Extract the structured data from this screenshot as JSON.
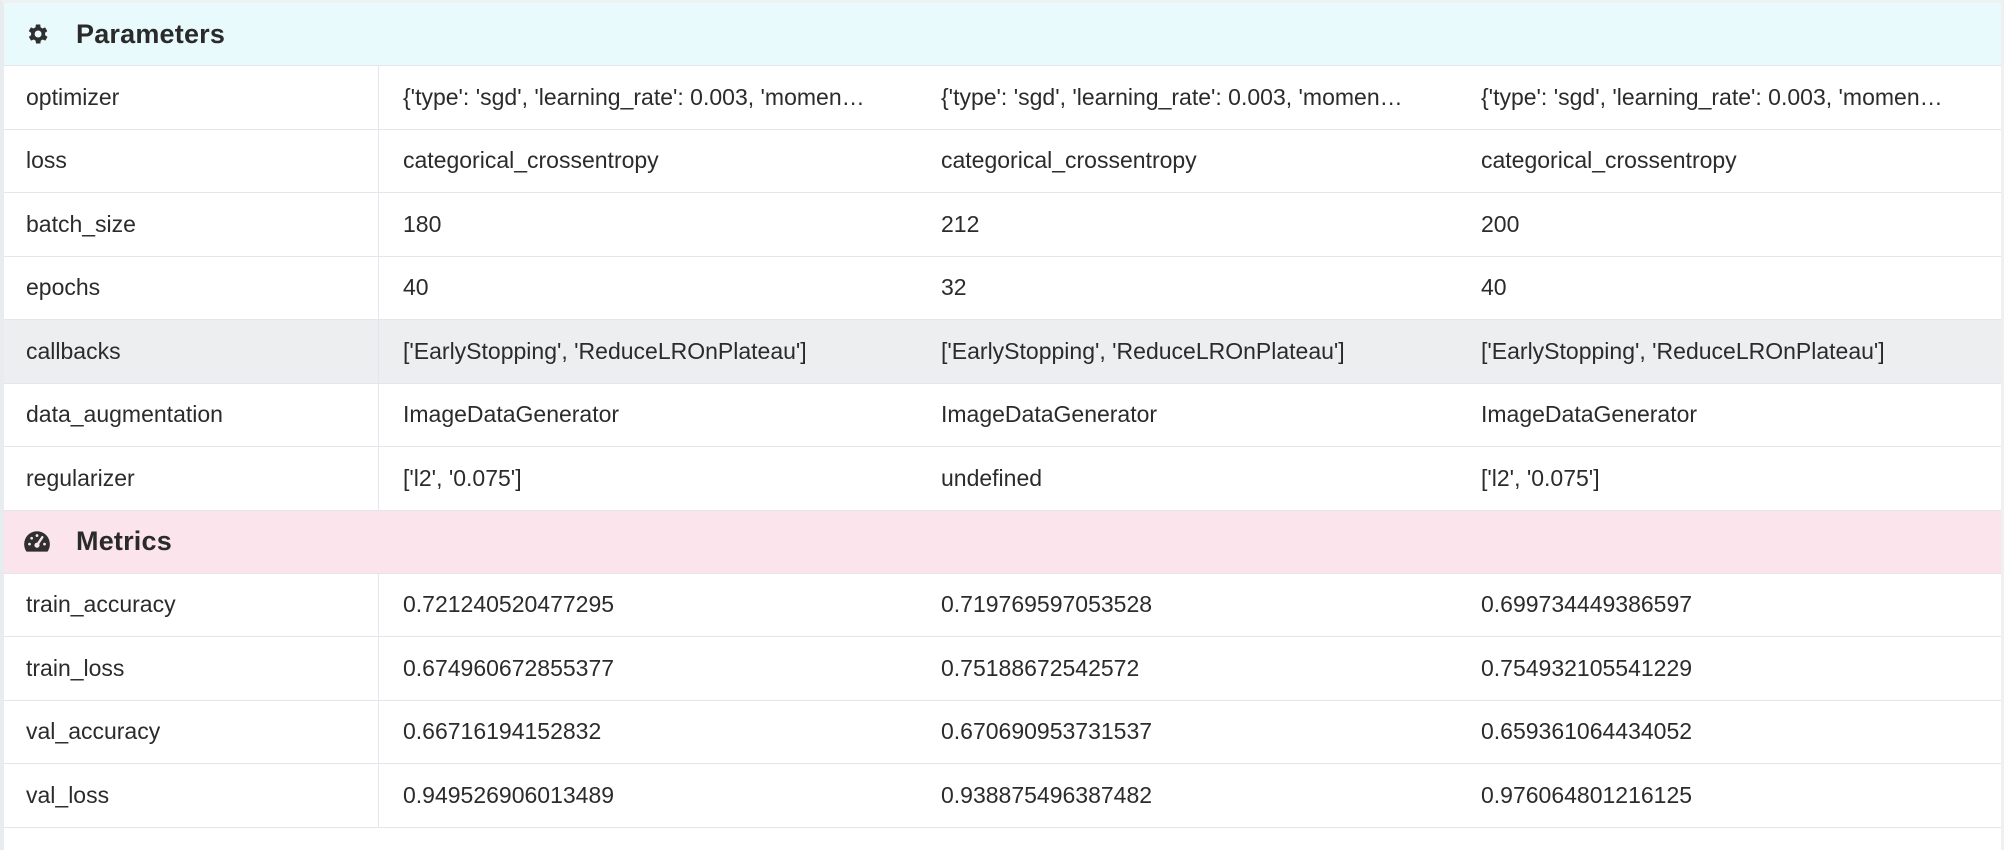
{
  "parameters": {
    "title": "Parameters",
    "icon": "gear-icon",
    "rows": [
      {
        "key": "optimizer",
        "values": [
          "{'type': 'sgd', 'learning_rate': 0.003, 'momen…",
          "{'type': 'sgd', 'learning_rate': 0.003, 'momen…",
          "{'type': 'sgd', 'learning_rate': 0.003, 'momen…"
        ]
      },
      {
        "key": "loss",
        "values": [
          "categorical_crossentropy",
          "categorical_crossentropy",
          "categorical_crossentropy"
        ]
      },
      {
        "key": "batch_size",
        "values": [
          "180",
          "212",
          "200"
        ]
      },
      {
        "key": "epochs",
        "values": [
          "40",
          "32",
          "40"
        ]
      },
      {
        "key": "callbacks",
        "values": [
          "['EarlyStopping', 'ReduceLROnPlateau']",
          "['EarlyStopping', 'ReduceLROnPlateau']",
          "['EarlyStopping', 'ReduceLROnPlateau']"
        ]
      },
      {
        "key": "data_augmentation",
        "values": [
          "ImageDataGenerator",
          "ImageDataGenerator",
          "ImageDataGenerator"
        ]
      },
      {
        "key": "regularizer",
        "values": [
          "['l2', '0.075']",
          "undefined",
          "['l2', '0.075']"
        ]
      }
    ]
  },
  "metrics": {
    "title": "Metrics",
    "icon": "speedometer-icon",
    "rows": [
      {
        "key": "train_accuracy",
        "values": [
          "0.721240520477295",
          "0.719769597053528",
          "0.699734449386597"
        ]
      },
      {
        "key": "train_loss",
        "values": [
          "0.674960672855377",
          "0.75188672542572",
          "0.754932105541229"
        ]
      },
      {
        "key": "val_accuracy",
        "values": [
          "0.66716194152832",
          "0.670690953731537",
          "0.659361064434052"
        ]
      },
      {
        "key": "val_loss",
        "values": [
          "0.949526906013489",
          "0.938875496387482",
          "0.976064801216125"
        ]
      }
    ]
  },
  "colors": {
    "parameters_header_bg": "#e8fafc",
    "metrics_header_bg": "#fbe4ec",
    "highlight_row_bg": "#eceef0",
    "border": "#e3e6ea"
  }
}
